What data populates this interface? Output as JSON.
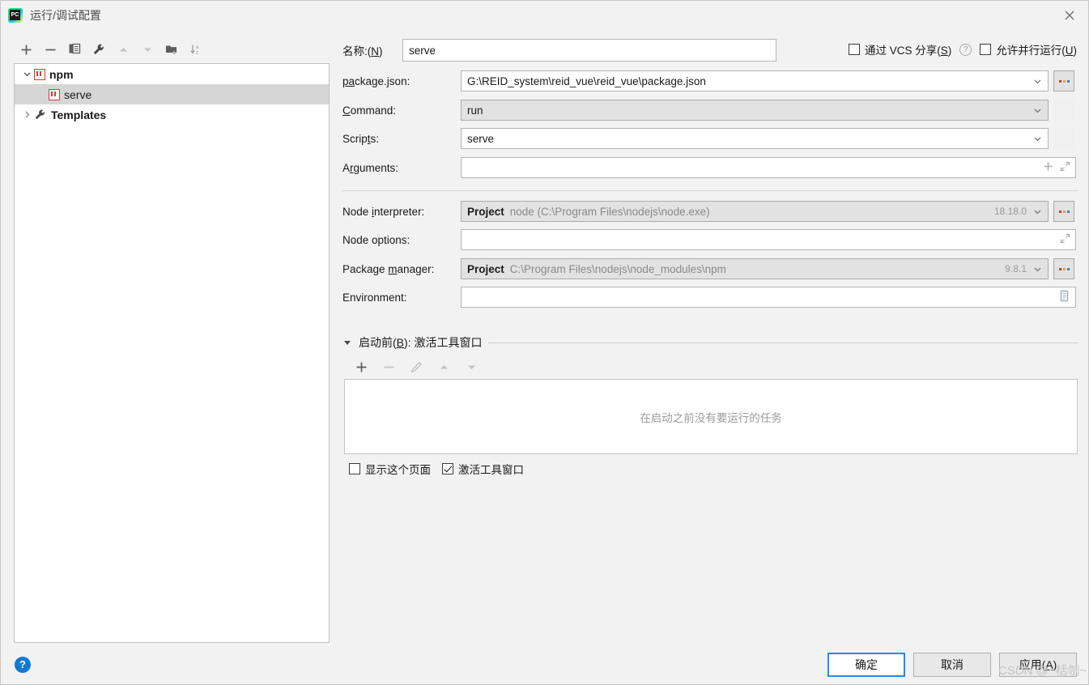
{
  "window": {
    "title": "运行/调试配置",
    "app_icon": "pycharm-icon",
    "close_icon": "close-icon"
  },
  "tree_toolbar": {
    "buttons": [
      {
        "name": "add-configuration-button",
        "icon": "plus-icon",
        "enabled": true
      },
      {
        "name": "remove-configuration-button",
        "icon": "minus-icon",
        "enabled": true
      },
      {
        "name": "copy-configuration-button",
        "icon": "copy-icon",
        "enabled": true
      },
      {
        "name": "edit-templates-button",
        "icon": "wrench-icon",
        "enabled": true
      },
      {
        "name": "move-up-button",
        "icon": "arrow-up-icon",
        "enabled": false
      },
      {
        "name": "move-down-button",
        "icon": "arrow-down-icon",
        "enabled": false
      },
      {
        "name": "new-folder-button",
        "icon": "folder-add-icon",
        "enabled": true
      },
      {
        "name": "sort-configurations-button",
        "icon": "sort-az-icon",
        "enabled": true
      }
    ]
  },
  "tree": {
    "nodes": [
      {
        "label": "npm",
        "icon": "npm-icon",
        "bold": true,
        "expanded": true,
        "level": 0,
        "selected": false
      },
      {
        "label": "serve",
        "icon": "npm-icon",
        "bold": false,
        "level": 1,
        "selected": true
      },
      {
        "label": "Templates",
        "icon": "wrench-icon",
        "bold": true,
        "expanded": false,
        "level": 0,
        "selected": false
      }
    ]
  },
  "form": {
    "name_label": "名称:(N)",
    "name_label_pre": "名称:(",
    "name_label_mnemonic": "N",
    "name_label_post": ")",
    "name_value": "serve",
    "share_vcs_label_pre": "通过 VCS 分享(",
    "share_vcs_mnemonic": "S",
    "share_vcs_post": ")",
    "share_vcs_checked": false,
    "share_help_icon": "help-icon",
    "allow_parallel_label_pre": "允许并行运行(",
    "allow_parallel_mnemonic": "U",
    "allow_parallel_post": ")",
    "allow_parallel_checked": false,
    "package_json_label_pre": "p",
    "package_json_label_mnemonic": "a",
    "package_json_label_post": "ckage.json:",
    "package_json_value": "G:\\REID_system\\reid_vue\\reid_vue\\package.json",
    "command_label_mnemonic": "C",
    "command_label_post": "ommand:",
    "command_value": "run",
    "scripts_label_pre": "Scrip",
    "scripts_label_mnemonic": "t",
    "scripts_label_post": "s:",
    "scripts_value": "serve",
    "arguments_label_pre": "A",
    "arguments_label_mnemonic": "r",
    "arguments_label_post": "guments:",
    "arguments_value": "",
    "node_interpreter_label_pre": "Node ",
    "node_interpreter_label_mnemonic": "i",
    "node_interpreter_label_post": "nterpreter:",
    "node_interpreter_scope": "Project",
    "node_interpreter_path": "node (C:\\Program Files\\nodejs\\node.exe)",
    "node_interpreter_version": "18.18.0",
    "node_options_label": "Node options:",
    "node_options_value": "",
    "package_manager_label_pre": "Package ",
    "package_manager_label_mnemonic": "m",
    "package_manager_label_post": "anager:",
    "package_manager_scope": "Project",
    "package_manager_path": "C:\\Program Files\\nodejs\\node_modules\\npm",
    "package_manager_version": "9.8.1",
    "environment_label": "Environment:",
    "environment_value": ""
  },
  "before_launch": {
    "title_pre": "启动前(",
    "title_mnemonic": "B",
    "title_post": "): 激活工具窗口",
    "toolbar": [
      {
        "name": "add-task-button",
        "icon": "plus-icon",
        "enabled": true
      },
      {
        "name": "remove-task-button",
        "icon": "minus-icon",
        "enabled": false
      },
      {
        "name": "edit-task-button",
        "icon": "pencil-icon",
        "enabled": false
      },
      {
        "name": "task-move-up-button",
        "icon": "arrow-up-icon",
        "enabled": false
      },
      {
        "name": "task-move-down-button",
        "icon": "arrow-down-icon",
        "enabled": false
      }
    ],
    "empty_text": "在启动之前没有要运行的任务",
    "show_page_label": "显示这个页面",
    "show_page_checked": false,
    "activate_toolwindow_label": "激活工具窗口",
    "activate_toolwindow_checked": true
  },
  "footer": {
    "help_icon": "question-mark-icon",
    "ok_label": "确定",
    "cancel_label": "取消",
    "apply_label_pre": "应用(",
    "apply_label_mnemonic": "A",
    "apply_label_post": ")",
    "watermark": "CSDN @~栝刎~"
  },
  "colors": {
    "dialog_bg": "#f2f2f2",
    "panel_bg": "#ffffff",
    "selection": "#d6d6d6",
    "accent_blue": "#1a8cff",
    "help_blue": "#1279d1",
    "npm_red": "#d33b34",
    "disabled_text": "#9a9a9a"
  }
}
